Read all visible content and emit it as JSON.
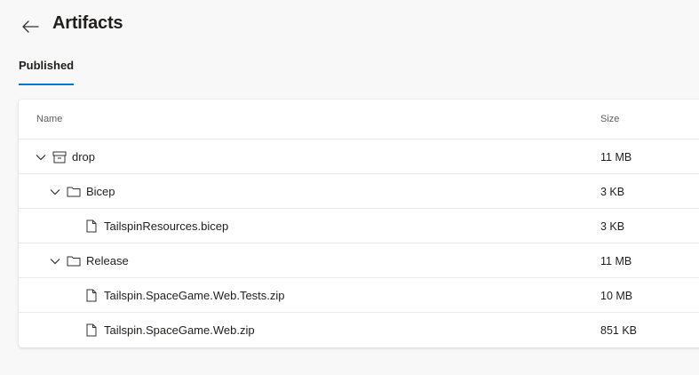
{
  "header": {
    "title": "Artifacts"
  },
  "tabs": [
    {
      "label": "Published"
    }
  ],
  "table": {
    "columns": {
      "name": "Name",
      "size": "Size"
    },
    "rows": [
      {
        "name": "drop",
        "size": "11 MB",
        "level": 0,
        "kind": "artifact",
        "expanded": true
      },
      {
        "name": "Bicep",
        "size": "3 KB",
        "level": 1,
        "kind": "folder",
        "expanded": true
      },
      {
        "name": "TailspinResources.bicep",
        "size": "3 KB",
        "level": 2,
        "kind": "file"
      },
      {
        "name": "Release",
        "size": "11 MB",
        "level": 1,
        "kind": "folder",
        "expanded": true
      },
      {
        "name": "Tailspin.SpaceGame.Web.Tests.zip",
        "size": "10 MB",
        "level": 2,
        "kind": "file"
      },
      {
        "name": "Tailspin.SpaceGame.Web.zip",
        "size": "851 KB",
        "level": 2,
        "kind": "file"
      }
    ]
  },
  "colors": {
    "accent": "#0078d4",
    "background": "#f8f8f8",
    "card": "#ffffff"
  }
}
